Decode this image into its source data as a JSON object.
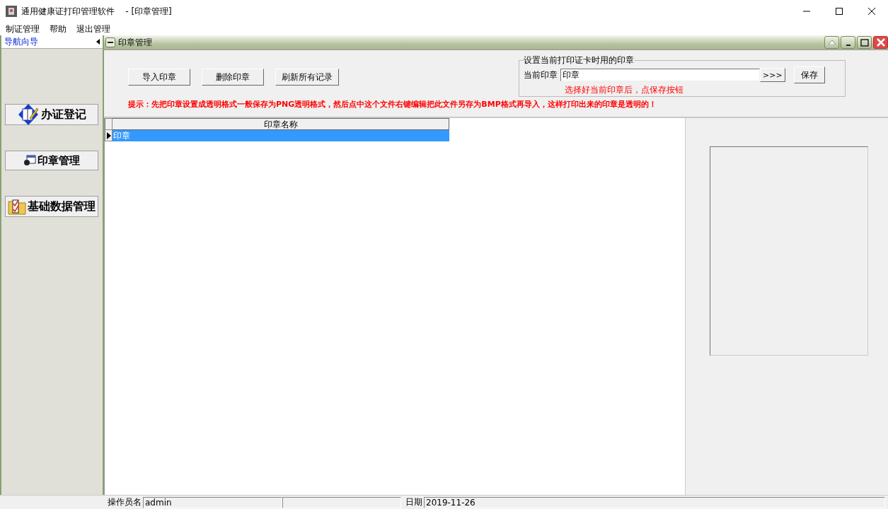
{
  "window": {
    "title": "通用健康证打印管理软件    - [印章管理]"
  },
  "menu": [
    {
      "label": "制证管理"
    },
    {
      "label": "帮助"
    },
    {
      "label": "退出管理"
    }
  ],
  "nav": {
    "title": "导航向导",
    "items": [
      {
        "label": "办证登记",
        "kind": "register"
      },
      {
        "label": "印章管理",
        "kind": "seal"
      },
      {
        "label": "基础数据管理",
        "kind": "data"
      }
    ]
  },
  "child": {
    "title": "印章管理"
  },
  "toolbar": {
    "buttons": [
      "导入印章",
      "删除印章",
      "刷新所有记录"
    ]
  },
  "seal_group": {
    "title": "设置当前打印证卡时用的印章",
    "label": "当前印章",
    "value": "印章",
    "browse": ">>>",
    "save": "保存",
    "hint": "选择好当前印章后，点保存按钮"
  },
  "tip": "提示：先把印章设置成透明格式一般保存为PNG透明格式，然后点中这个文件右键编辑把此文件另存为BMP格式再导入，这样打印出来的印章是透明的！",
  "table": {
    "columns": [
      "印章名称"
    ],
    "rows": [
      {
        "cells": [
          "印章"
        ],
        "selected": true
      }
    ]
  },
  "status_bar": {
    "operator_label": "操作员名",
    "operator": "admin",
    "date_label": "日期",
    "date": "2019-11-26"
  }
}
